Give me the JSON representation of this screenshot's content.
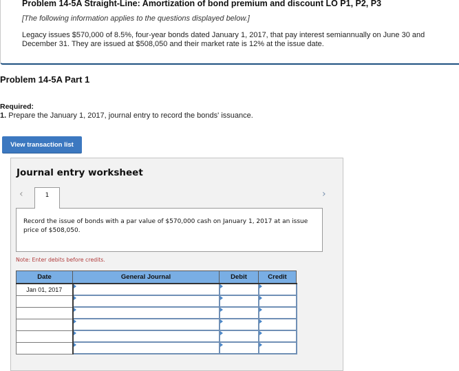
{
  "intro": {
    "title": "Problem 14-5A Straight-Line: Amortization of bond premium and discount LO P1, P2, P3",
    "note": "[The following information applies to the questions displayed below.]",
    "text": "Legacy issues $570,000 of 8.5%, four-year bonds dated January 1, 2017, that pay interest semiannually on June 30 and December 31. They are issued at $508,050 and their market rate is 12% at the issue date."
  },
  "part": {
    "title": "Problem 14-5A Part 1",
    "required_label": "Required:",
    "required_number": "1.",
    "required_text": " Prepare the January 1, 2017, journal entry to record the bonds' issuance."
  },
  "buttons": {
    "view_transaction_list": "View transaction list"
  },
  "worksheet": {
    "title": "Journal entry worksheet",
    "prev_icon": "‹",
    "next_icon": "›",
    "tabs": [
      {
        "label": "1",
        "active": true
      }
    ],
    "description": "Record the issue of bonds with a par value of $570,000 cash on January 1, 2017 at an issue price of $508,050.",
    "note": "Note: Enter debits before credits.",
    "table": {
      "headers": [
        "Date",
        "General Journal",
        "Debit",
        "Credit"
      ],
      "rows": [
        {
          "date": "Jan 01, 2017",
          "account": "",
          "debit": "",
          "credit": ""
        },
        {
          "date": "",
          "account": "",
          "debit": "",
          "credit": ""
        },
        {
          "date": "",
          "account": "",
          "debit": "",
          "credit": ""
        },
        {
          "date": "",
          "account": "",
          "debit": "",
          "credit": ""
        },
        {
          "date": "",
          "account": "",
          "debit": "",
          "credit": ""
        },
        {
          "date": "",
          "account": "",
          "debit": "",
          "credit": ""
        }
      ]
    }
  },
  "colors": {
    "accent_blue": "#3c78c0",
    "header_blue": "#79aee4",
    "note_red": "#b03a3a",
    "rule_navy": "#1d4f80"
  }
}
